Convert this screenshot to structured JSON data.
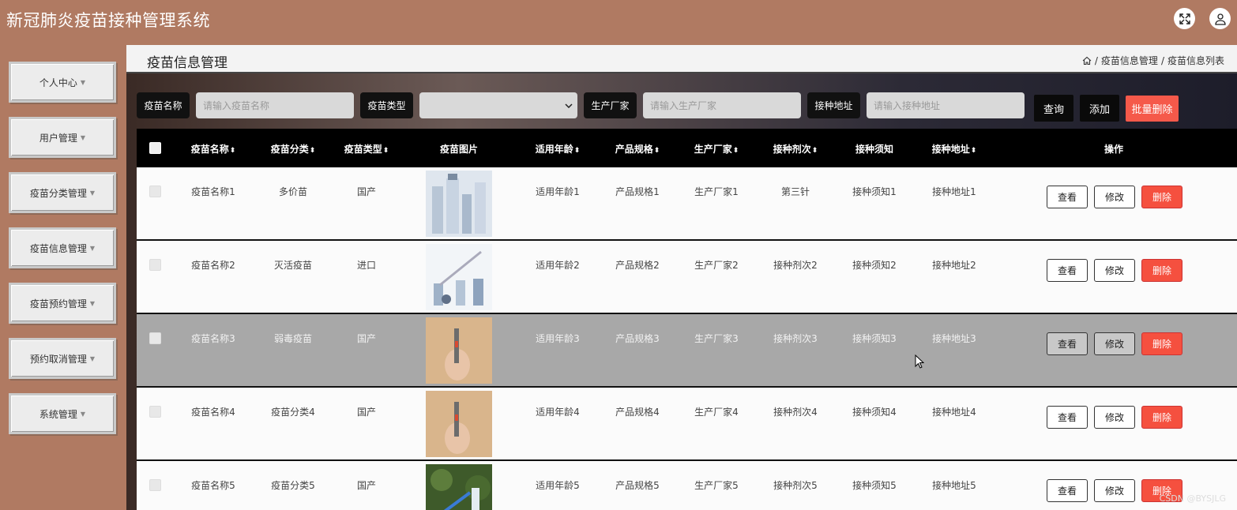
{
  "header": {
    "title": "新冠肺炎疫苗接种管理系统"
  },
  "sidebar": {
    "items": [
      {
        "label": "个人中心"
      },
      {
        "label": "用户管理"
      },
      {
        "label": "疫苗分类管理"
      },
      {
        "label": "疫苗信息管理"
      },
      {
        "label": "疫苗预约管理"
      },
      {
        "label": "预约取消管理"
      },
      {
        "label": "系统管理"
      }
    ]
  },
  "page": {
    "title": "疫苗信息管理",
    "breadcrumb": [
      "疫苗信息管理",
      "疫苗信息列表"
    ],
    "breadcrumb_sep": "/"
  },
  "search": {
    "name_label": "疫苗名称",
    "name_placeholder": "请输入疫苗名称",
    "type_label": "疫苗类型",
    "maker_label": "生产厂家",
    "maker_placeholder": "请输入生产厂家",
    "site_label": "接种地址",
    "site_placeholder": "请输入接种地址",
    "query_btn": "查询",
    "add_btn": "添加",
    "batch_delete_btn": "批量删除"
  },
  "table": {
    "columns": [
      "疫苗名称",
      "疫苗分类",
      "疫苗类型",
      "疫苗图片",
      "适用年龄",
      "产品规格",
      "生产厂家",
      "接种剂次",
      "接种须知",
      "接种地址",
      "操作"
    ],
    "rows": [
      {
        "name": "疫苗名称1",
        "category": "多价苗",
        "type": "国产",
        "age": "适用年龄1",
        "spec": "产品规格1",
        "maker": "生产厂家1",
        "dose": "第三针",
        "notice": "接种须知1",
        "site": "接种地址1"
      },
      {
        "name": "疫苗名称2",
        "category": "灭活疫苗",
        "type": "进口",
        "age": "适用年龄2",
        "spec": "产品规格2",
        "maker": "生产厂家2",
        "dose": "接种剂次2",
        "notice": "接种须知2",
        "site": "接种地址2"
      },
      {
        "name": "疫苗名称3",
        "category": "弱毒疫苗",
        "type": "国产",
        "age": "适用年龄3",
        "spec": "产品规格3",
        "maker": "生产厂家3",
        "dose": "接种剂次3",
        "notice": "接种须知3",
        "site": "接种地址3"
      },
      {
        "name": "疫苗名称4",
        "category": "疫苗分类4",
        "type": "国产",
        "age": "适用年龄4",
        "spec": "产品规格4",
        "maker": "生产厂家4",
        "dose": "接种剂次4",
        "notice": "接种须知4",
        "site": "接种地址4"
      },
      {
        "name": "疫苗名称5",
        "category": "疫苗分类5",
        "type": "国产",
        "age": "适用年龄5",
        "spec": "产品规格5",
        "maker": "生产厂家5",
        "dose": "接种剂次5",
        "notice": "接种须知5",
        "site": "接种地址5"
      }
    ],
    "actions": {
      "view": "查看",
      "edit": "修改",
      "delete": "删除"
    }
  },
  "watermark": "CSDN @BYSJLG",
  "colors": {
    "brand": "#b07a62",
    "danger": "#f5594a",
    "header_bg": "#000000"
  }
}
